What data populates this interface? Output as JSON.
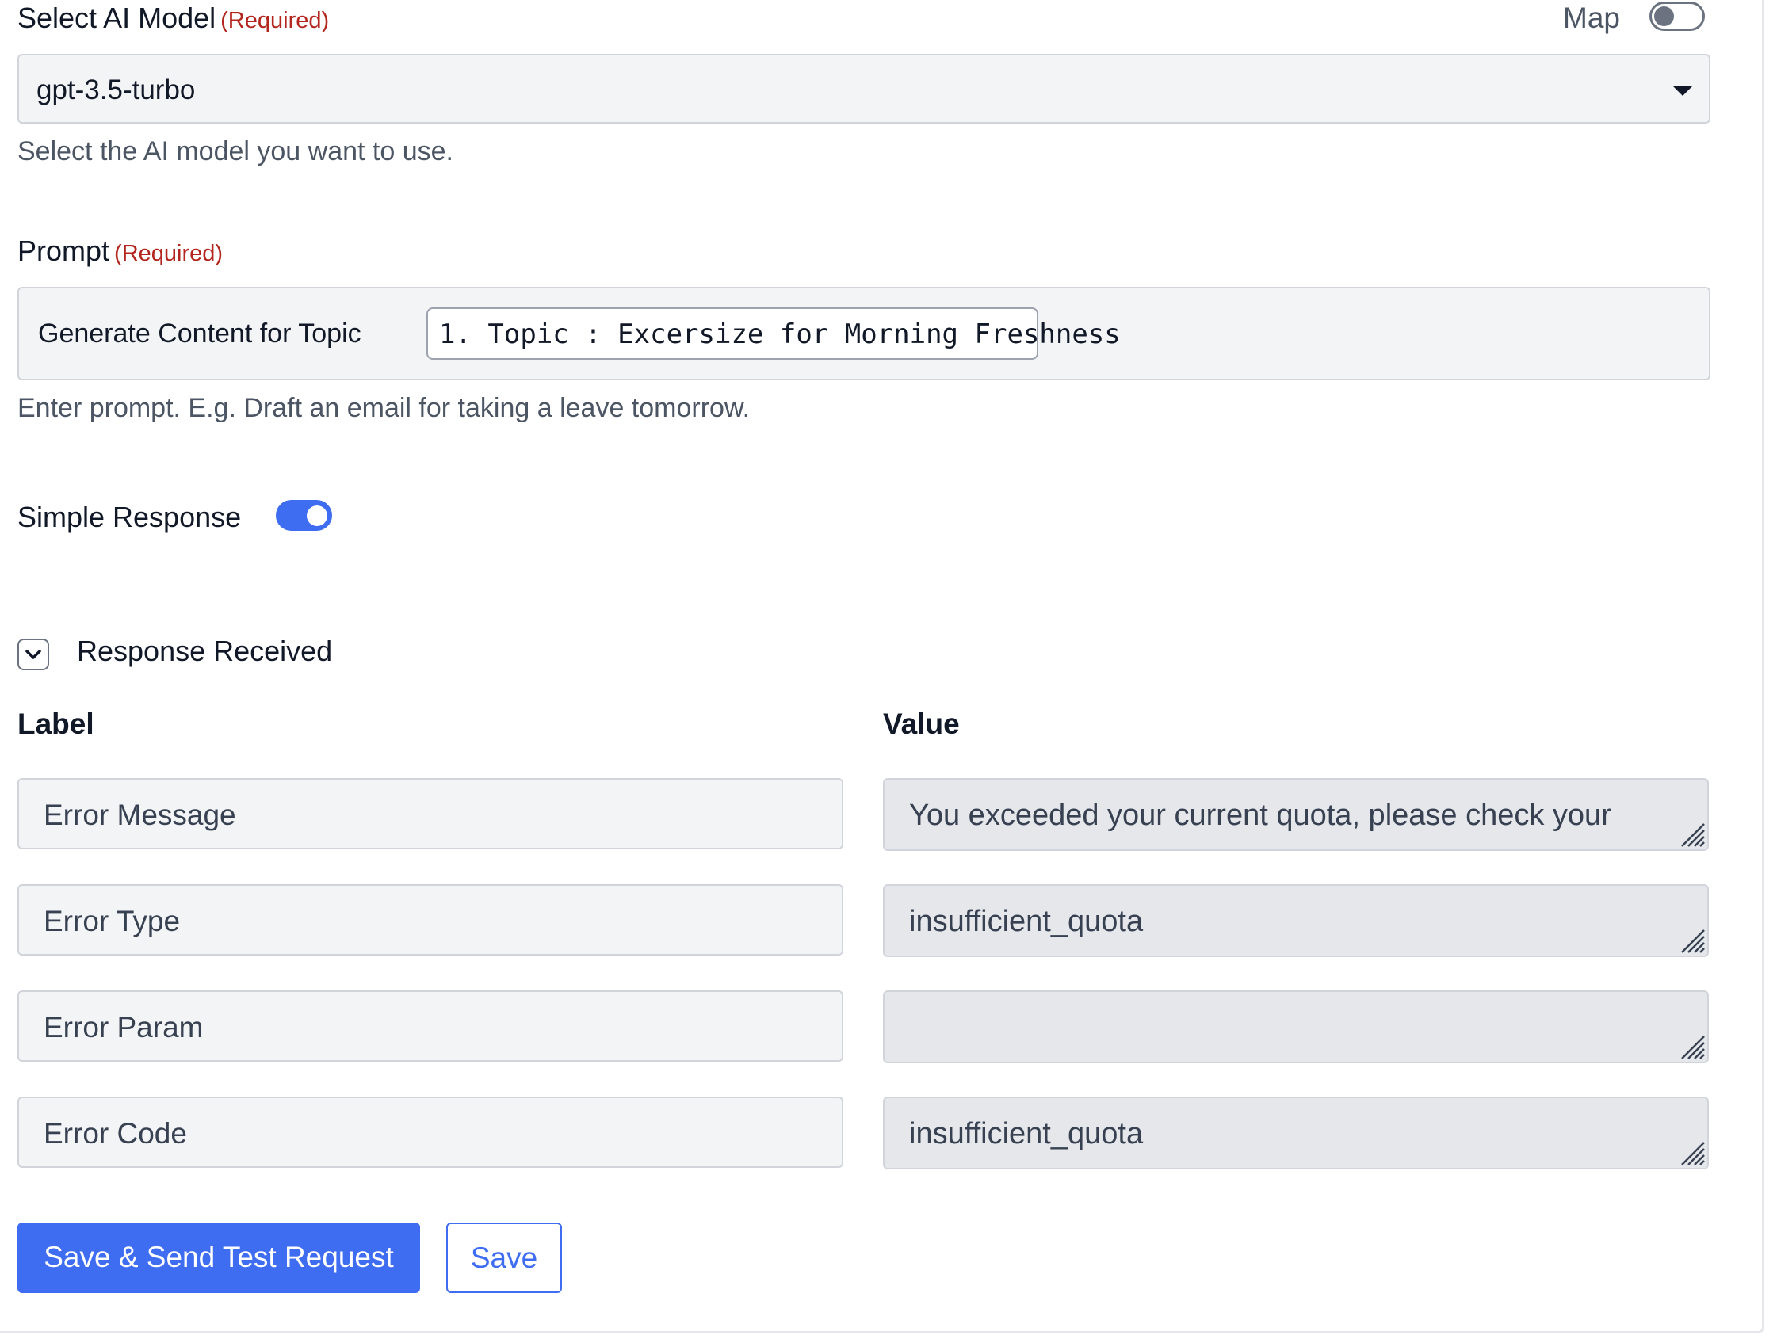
{
  "model_field": {
    "label": "Select AI Model",
    "required": "(Required)",
    "map_label": "Map",
    "map_enabled": false,
    "selected": "gpt-3.5-turbo",
    "help": "Select the AI model you want to use."
  },
  "prompt_field": {
    "label": "Prompt",
    "required": "(Required)",
    "text": "Generate Content for Topic",
    "chip": "1. Topic : Excersize for Morning Freshness",
    "help": "Enter prompt. E.g. Draft an email for taking a leave tomorrow."
  },
  "simple_response": {
    "label": "Simple Response",
    "enabled": true
  },
  "response_section": {
    "title": "Response Received",
    "label_header": "Label",
    "value_header": "Value",
    "rows": [
      {
        "label": "Error Message",
        "value": "You exceeded your current quota, please check your"
      },
      {
        "label": "Error Type",
        "value": "insufficient_quota"
      },
      {
        "label": "Error Param",
        "value": ""
      },
      {
        "label": "Error Code",
        "value": "insufficient_quota"
      }
    ]
  },
  "buttons": {
    "save_send": "Save & Send Test Request",
    "save": "Save"
  },
  "colors": {
    "accent": "#3f6df2",
    "required": "#b3261e",
    "input_bg": "#f3f4f6",
    "readonly_bg": "#e5e7eb"
  }
}
